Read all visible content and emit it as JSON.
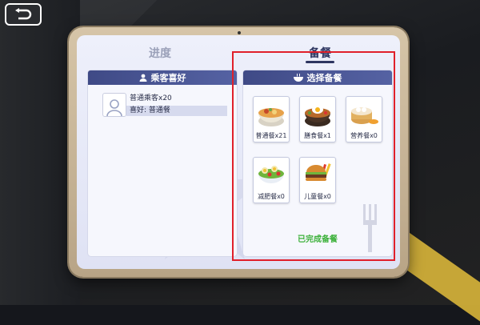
{
  "tabs": {
    "progress": "进度",
    "meal": "备餐"
  },
  "left_panel": {
    "title": "乘客喜好",
    "passenger_count": "普通乘客x20",
    "preference": "喜好: 普通餐"
  },
  "right_panel": {
    "title": "选择备餐",
    "meals": [
      {
        "label": "普通餐x21",
        "icon": "noodle-bowl-icon"
      },
      {
        "label": "膳食餐x1",
        "icon": "rice-egg-bowl-icon"
      },
      {
        "label": "营养餐x0",
        "icon": "dumpling-steamer-icon"
      },
      {
        "label": "减肥餐x0",
        "icon": "salad-bowl-icon"
      },
      {
        "label": "儿童餐x0",
        "icon": "burger-icon"
      }
    ],
    "status": "已完成备餐"
  },
  "colors": {
    "header": "#3f4a86",
    "status_green": "#3db13b",
    "highlight": "#e0202a"
  }
}
